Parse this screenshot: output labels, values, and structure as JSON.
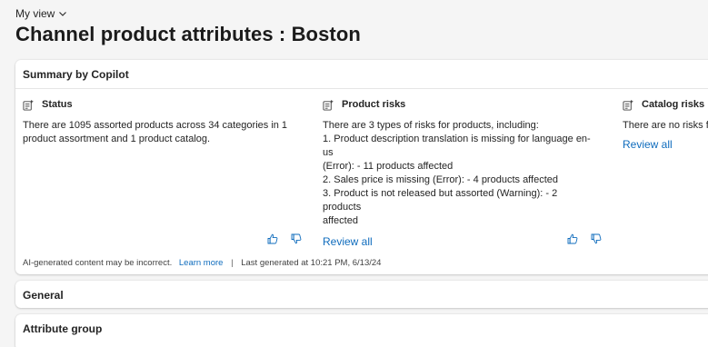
{
  "view": {
    "label": "My view"
  },
  "page": {
    "title": "Channel product attributes : Boston"
  },
  "summary": {
    "header": "Summary by Copilot",
    "columns": [
      {
        "title": "Status",
        "text": "There are 1095 assorted products across 34 categories in 1\nproduct assortment and 1 product catalog.",
        "link": ""
      },
      {
        "title": "Product risks",
        "text": "There are 3 types of risks for products, including:\n1. Product description translation is missing for language en-us\n(Error): - 11 products affected\n2. Sales price is missing (Error): - 4 products affected\n3. Product is not released but assorted (Warning): - 2 products\naffected",
        "link": "Review all"
      },
      {
        "title": "Catalog risks",
        "text": "There are no risks fo",
        "link": "Review all"
      }
    ],
    "footer": {
      "disclaimer": "AI-generated content may be incorrect.",
      "learn_more": "Learn more",
      "separator": "|",
      "last_generated": "Last generated at 10:21 PM, 6/13/24"
    }
  },
  "sections": {
    "general": "General",
    "attribute_group": "Attribute group"
  },
  "colors": {
    "link": "#0f6cbd",
    "background": "#f5f5f5"
  }
}
